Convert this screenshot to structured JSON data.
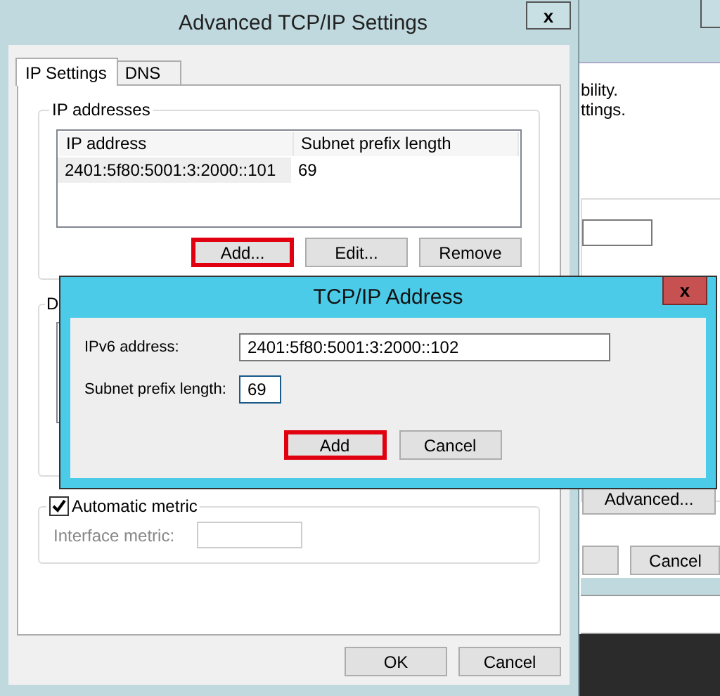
{
  "background_window": {
    "texts": [
      "bility.",
      "ttings."
    ],
    "advanced_button": "Advanced...",
    "bottom_buttons": [
      "Cancel"
    ]
  },
  "dialog": {
    "title": "Advanced TCP/IP Settings",
    "close": "x",
    "tabs": [
      {
        "label": "IP Settings",
        "selected": true
      },
      {
        "label": "DNS",
        "selected": false
      }
    ],
    "ip_addresses": {
      "title": "IP addresses",
      "columns": [
        "IP address",
        "Subnet prefix length"
      ],
      "rows": [
        {
          "cells": [
            "2401:5f80:5001:3:2000::101",
            "69"
          ],
          "selected": true
        }
      ],
      "buttons": [
        {
          "label": "Add...",
          "highlighted": true
        },
        {
          "label": "Edit...",
          "highlighted": false
        },
        {
          "label": "Remove",
          "highlighted": false
        }
      ]
    },
    "second_group": {
      "title": "D"
    },
    "metric": {
      "checkbox": {
        "label": "Automatic metric",
        "checked": true
      },
      "field_label": "Interface metric:",
      "disabled": true
    },
    "buttons": [
      "OK",
      "Cancel"
    ]
  },
  "address_dialog": {
    "title": "TCP/IP Address",
    "close": "x",
    "fields": [
      {
        "label": "IPv6 address:",
        "value": "2401:5f80:5001:3:2000::102",
        "kind": "wide"
      },
      {
        "label": "Subnet prefix length:",
        "value": "69",
        "kind": "short"
      }
    ],
    "buttons": [
      {
        "label": "Add",
        "highlighted": true
      },
      {
        "label": "Cancel",
        "highlighted": false
      }
    ]
  }
}
